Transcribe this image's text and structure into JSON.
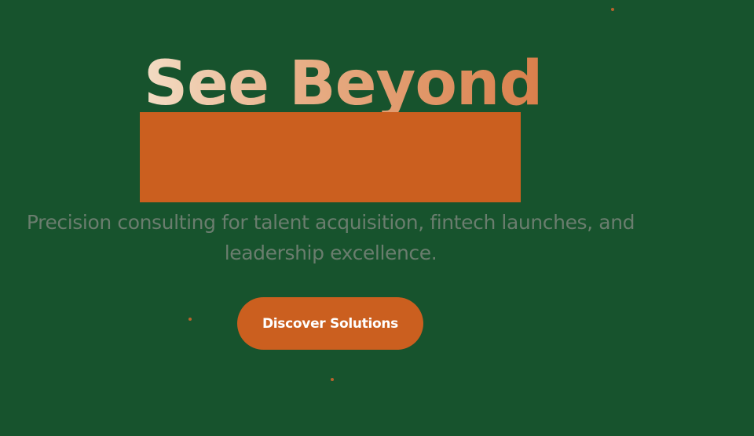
{
  "hero": {
    "title": "See Beyond",
    "subtitle": "Precision consulting for talent acquisition, fintech launches, and leadership excellence.",
    "cta_label": "Discover Solutions"
  },
  "colors": {
    "background": "#17532d",
    "accent": "#cb5f1f",
    "title_gradient_start": "#f3dcc4",
    "title_gradient_end": "#d97f4b",
    "subtitle": "#6a7d6e"
  }
}
